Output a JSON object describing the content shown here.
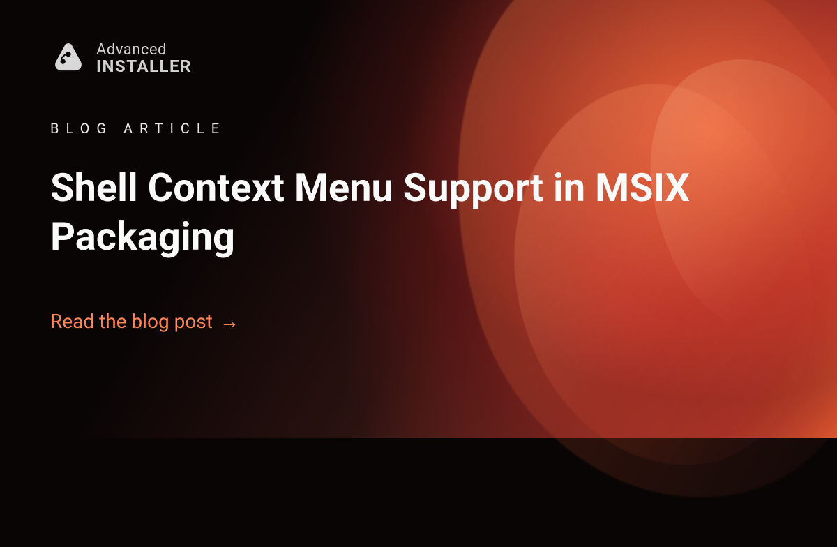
{
  "logo": {
    "top": "Advanced",
    "bottom": "INSTALLER"
  },
  "eyebrow": "BLOG ARTICLE",
  "title": "Shell Context Menu Support in MSIX Packaging",
  "cta": {
    "label": "Read the blog post",
    "arrow": "→"
  },
  "colors": {
    "accent": "#ff8455",
    "text_primary": "#fafafa",
    "text_secondary": "#d0d0d0"
  }
}
